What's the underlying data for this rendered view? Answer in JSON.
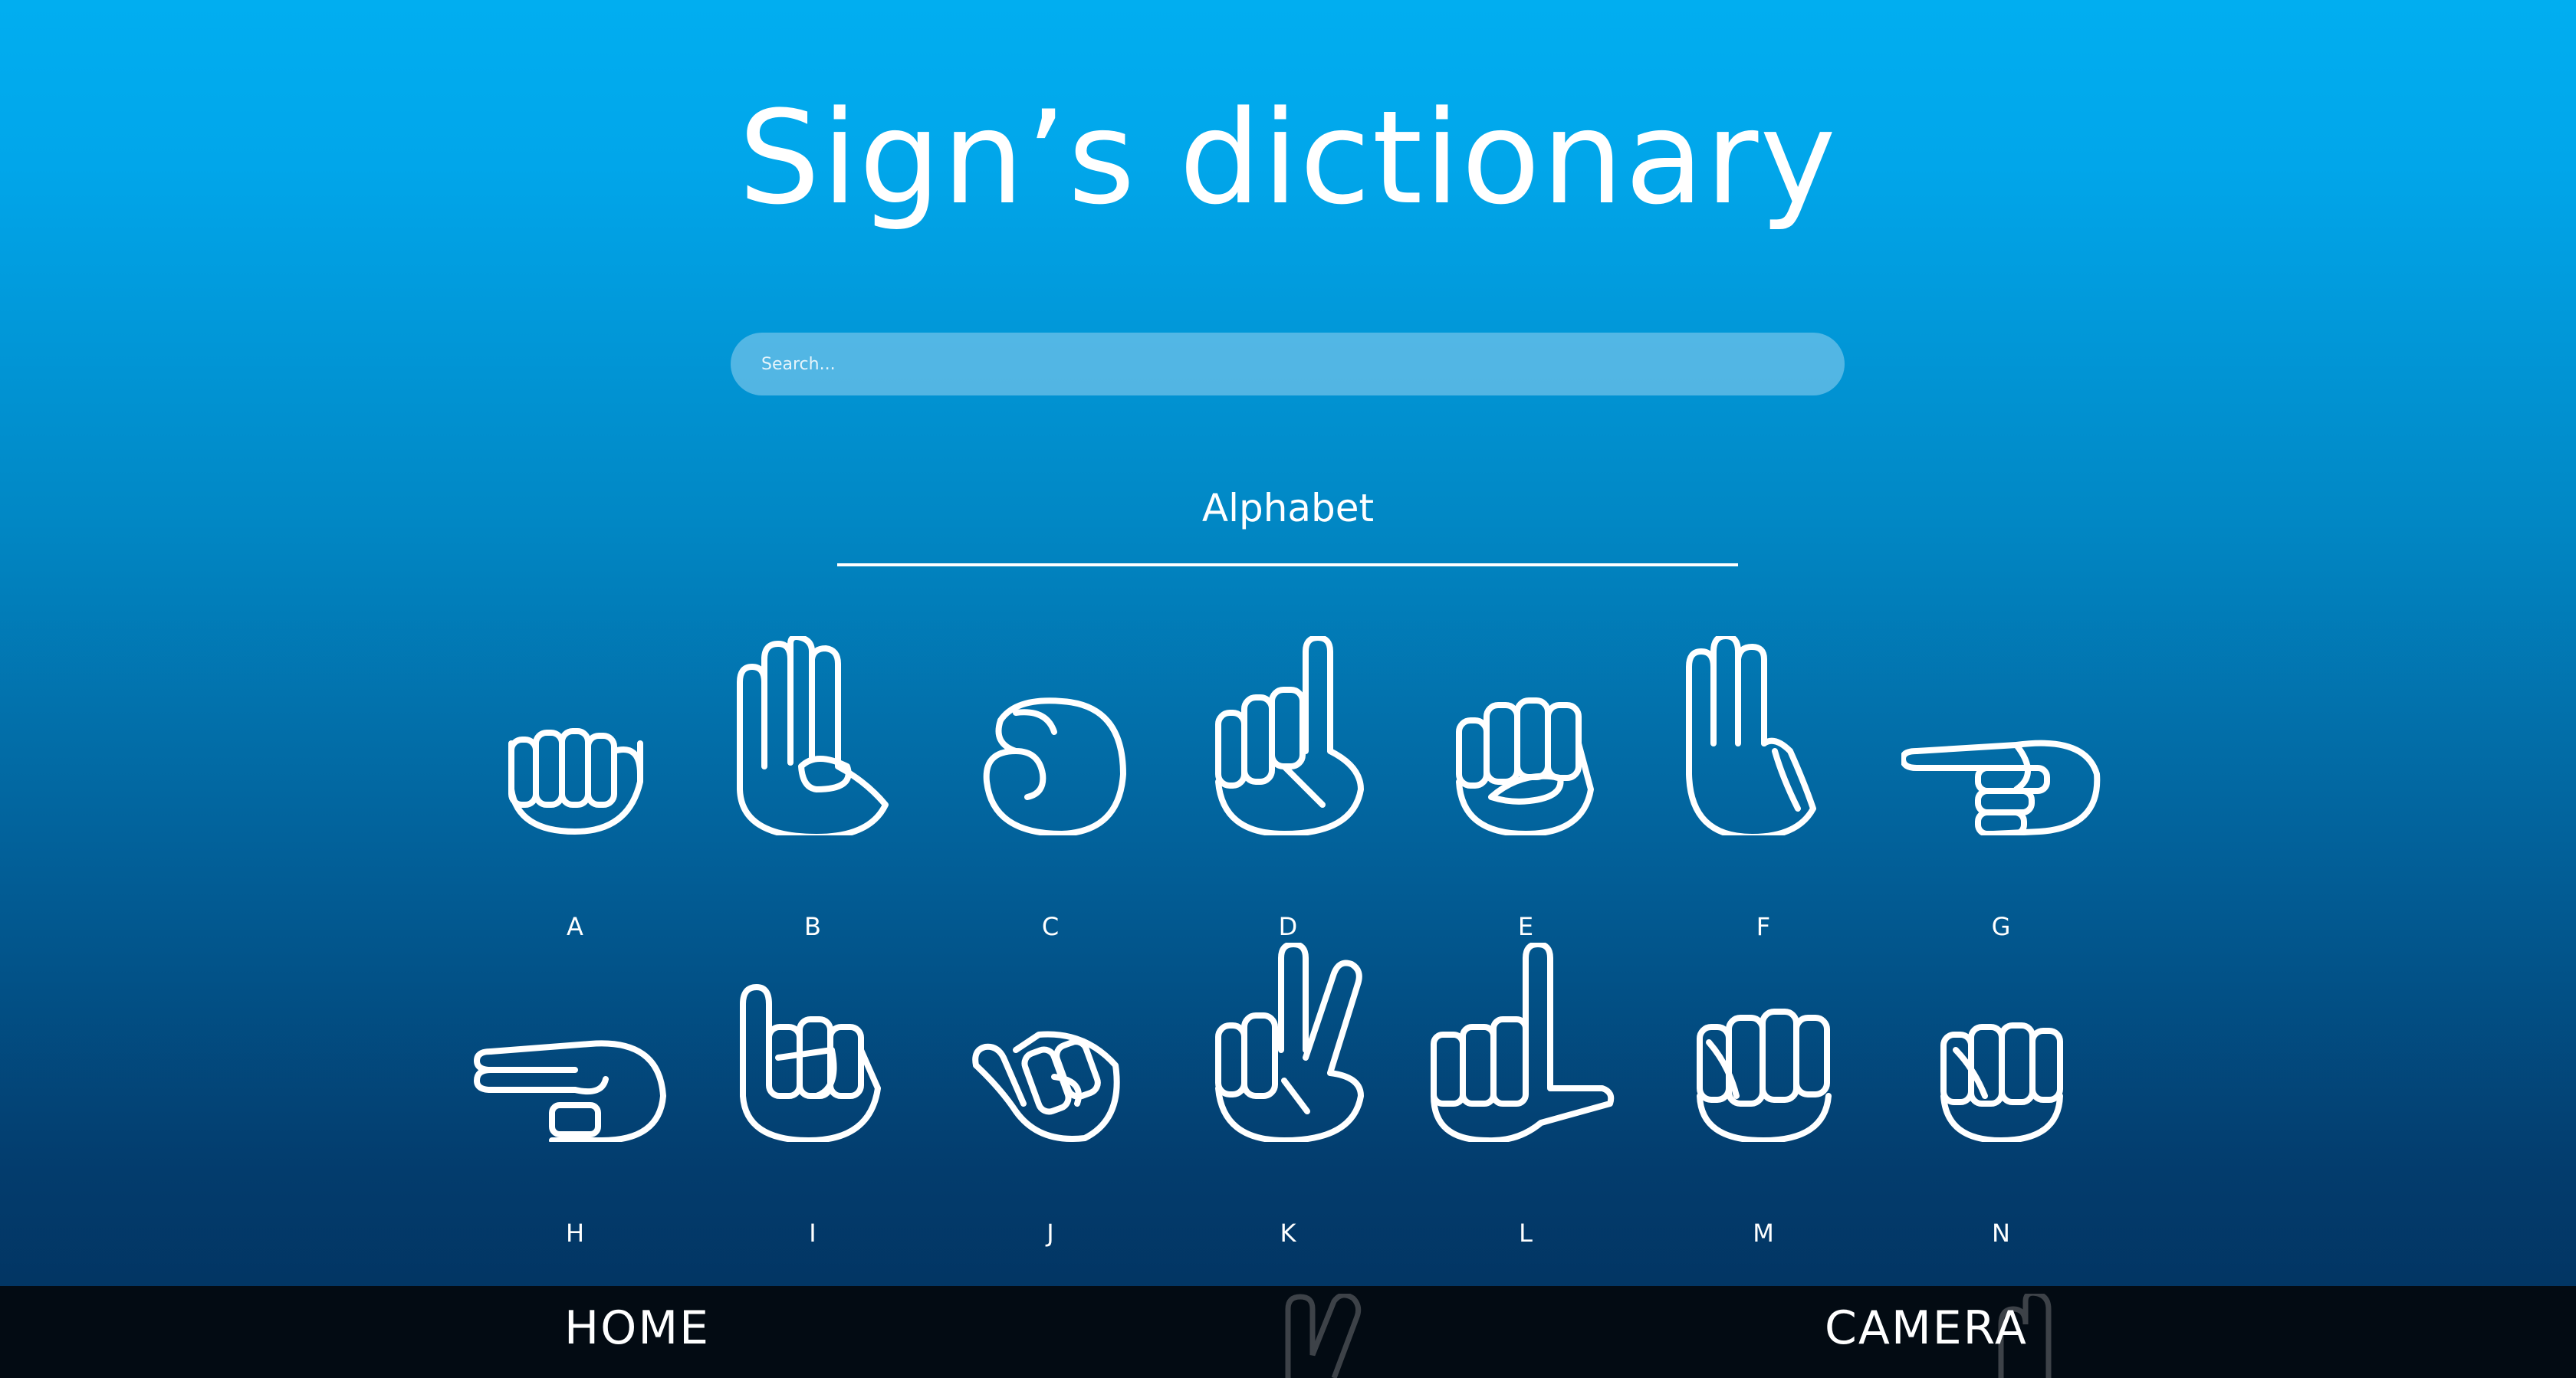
{
  "header": {
    "title": "Sign’s dictionary"
  },
  "search": {
    "placeholder": "Search..."
  },
  "section": {
    "title": "Alphabet"
  },
  "letters": [
    "A",
    "B",
    "C",
    "D",
    "E",
    "F",
    "G",
    "H",
    "I",
    "J",
    "K",
    "L",
    "M",
    "N"
  ],
  "nav": {
    "home": "HOME",
    "camera": "CAMERA"
  },
  "colors": {
    "gradient_top": "#01AEF0",
    "gradient_bottom": "#02305C",
    "nav_bg": "#030B13"
  },
  "icons": [
    "hand-sign-a-icon",
    "hand-sign-b-icon",
    "hand-sign-c-icon",
    "hand-sign-d-icon",
    "hand-sign-e-icon",
    "hand-sign-f-icon",
    "hand-sign-g-icon",
    "hand-sign-h-icon",
    "hand-sign-i-icon",
    "hand-sign-j-icon",
    "hand-sign-k-icon",
    "hand-sign-l-icon",
    "hand-sign-m-icon",
    "hand-sign-n-icon"
  ]
}
